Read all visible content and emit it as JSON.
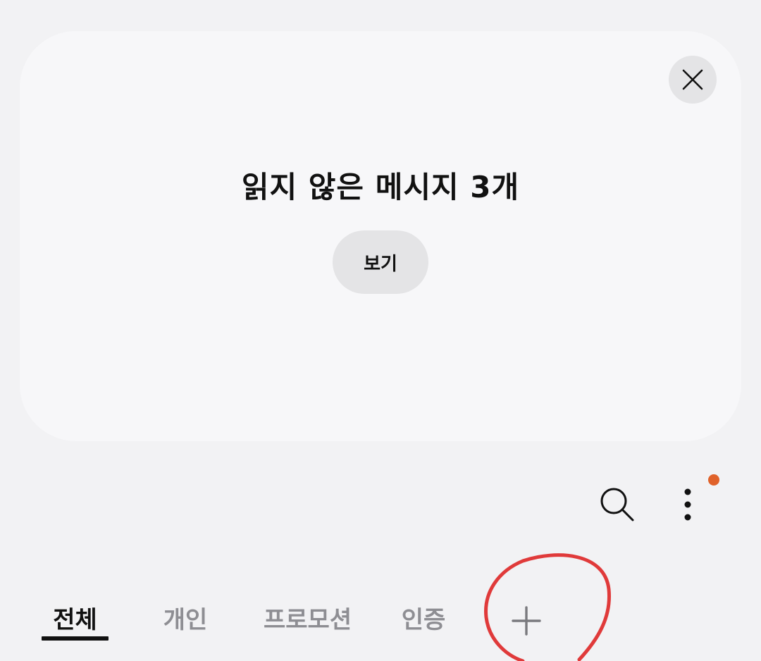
{
  "unread_card": {
    "title": "읽지 않은 메시지 3개",
    "view_button_label": "보기",
    "close_icon": "close-icon"
  },
  "toolbar": {
    "search_icon": "search-icon",
    "more_icon": "more-vertical-icon",
    "notification_dot_color": "#e0622a"
  },
  "tabs": [
    {
      "label": "전체",
      "active": true
    },
    {
      "label": "개인",
      "active": false
    },
    {
      "label": "프로모션",
      "active": false
    },
    {
      "label": "인증",
      "active": false
    }
  ],
  "add_tab_icon": "plus-icon",
  "annotation": {
    "color": "#e03a3a",
    "shape": "hand-drawn circle around add-tab button"
  }
}
